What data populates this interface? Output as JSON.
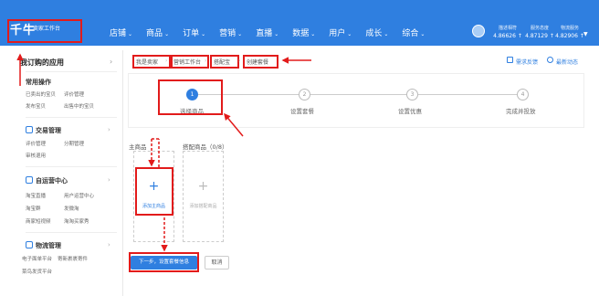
{
  "app": {
    "logo": "千牛",
    "logo_sub": "卖家工作台"
  },
  "nav": {
    "items": [
      "店铺",
      "商品",
      "订单",
      "营销",
      "直播",
      "数据",
      "用户",
      "成长",
      "综合"
    ]
  },
  "stats": [
    {
      "label": "描述相符",
      "value": "4.86626 ↑"
    },
    {
      "label": "服务态度",
      "value": "4.87129 ↑"
    },
    {
      "label": "物流服务",
      "value": "4.82906 ↑"
    }
  ],
  "sidebar": {
    "title": "我订购的应用",
    "sections": [
      {
        "title": "常用操作",
        "links": [
          "已卖出的宝贝",
          "评价管理",
          "发布宝贝",
          "出售中的宝贝"
        ]
      },
      {
        "title": "交易管理",
        "links": [
          "评价管理",
          "分期管理",
          "审核退用"
        ]
      },
      {
        "title": "自运营中心",
        "links": [
          "淘宝直播",
          "用户运营中心",
          "淘宝群",
          "发微淘",
          "商家短视频",
          "淘淘买家秀"
        ]
      },
      {
        "title": "物流管理",
        "links": [
          "电子面单平台",
          "寄新裹裹寄件",
          "菜鸟发货平台"
        ]
      }
    ]
  },
  "breadcrumb": [
    "我是卖家",
    "营销工作台",
    "搭配宝",
    "创建套餐"
  ],
  "header_links": {
    "feedback": "需求反馈",
    "news": "最新动态"
  },
  "steps": [
    "选择商品",
    "设置套餐",
    "设置优惠",
    "完成并投放"
  ],
  "products": {
    "main_label": "主商品",
    "match_label": "搭配商品（0/8）",
    "add_main": "添加主商品",
    "add_match": "添加搭配商品"
  },
  "buttons": {
    "next": "下一步，设置套餐信息",
    "cancel": "取消"
  },
  "colors": {
    "brand": "#2f7fe0",
    "annotation": "#e21b1b"
  }
}
